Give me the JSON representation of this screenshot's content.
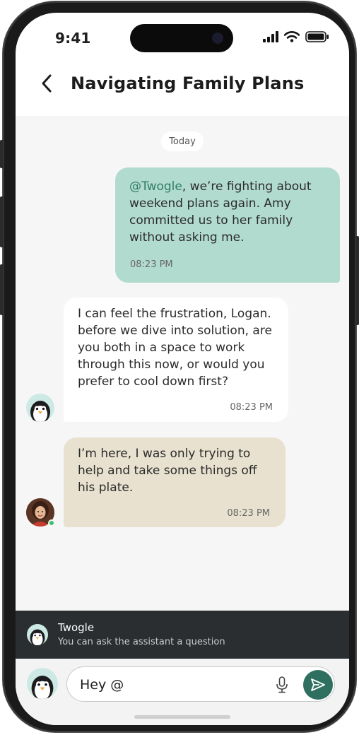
{
  "status_bar": {
    "time": "9:41"
  },
  "header": {
    "title": "Navigating Family Plans"
  },
  "chat": {
    "date_label": "Today",
    "messages": [
      {
        "mention": "@Twogle",
        "text": ", we’re fighting about weekend plans again. Amy committed us to her family without asking me.",
        "time": "08:23 PM"
      },
      {
        "text": "I can feel the frustration, Logan. before we dive into solution, are you both in a space to work through this now, or would you prefer to cool down first?",
        "time": "08:23 PM"
      },
      {
        "text": "I’m here, I was only trying to help and take some things off his plate.",
        "time": "08:23 PM"
      }
    ]
  },
  "assistant": {
    "name": "Twogle",
    "subtitle": "You can ask the assistant a question"
  },
  "composer": {
    "value": "Hey @"
  },
  "colors": {
    "user_bubble": "#b2dbcf",
    "assistant_bubble": "#ffffff",
    "partner_bubble": "#e8e1cf",
    "send_button": "#2e6f60",
    "assistant_bar": "#2a2e30"
  },
  "icons": [
    "back-arrow-icon",
    "signal-icon",
    "wifi-icon",
    "battery-icon",
    "penguin-icon",
    "microphone-icon",
    "send-icon"
  ]
}
